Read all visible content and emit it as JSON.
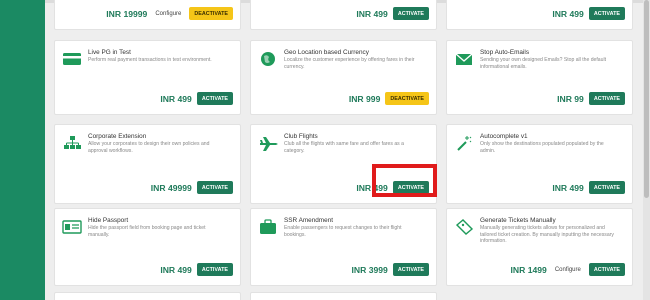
{
  "cards": [
    {
      "price": "INR 19999",
      "configure": "Configure",
      "button": "DEACTIVATE"
    },
    {
      "price": "INR 499",
      "button": "ACTIVATE"
    },
    {
      "price": "INR 499",
      "button": "ACTIVATE"
    },
    {
      "icon": "card-icon",
      "title": "Live PG in Test",
      "desc": "Perform real payment transactions in test environment.",
      "price": "INR 499",
      "button": "ACTIVATE"
    },
    {
      "icon": "globe-icon",
      "title": "Geo Location based Currency",
      "desc": "Localize the customer experience by offering fares in their currency.",
      "price": "INR 999",
      "button": "DEACTIVATE"
    },
    {
      "icon": "envelope-icon",
      "title": "Stop Auto-Emails",
      "desc": "Sending your own designed Emails? Stop all the default informational emails.",
      "price": "INR 99",
      "button": "ACTIVATE"
    },
    {
      "icon": "org-chart-icon",
      "title": "Corporate Extension",
      "desc": "Allow your corporates to design their own policies and approval workflows.",
      "price": "INR 49999",
      "button": "ACTIVATE"
    },
    {
      "icon": "airplane-icon",
      "title": "Club Flights",
      "desc": "Club all the flights with same fare and offer fares as a category.",
      "price": "INR 499",
      "button": "ACTIVATE"
    },
    {
      "icon": "cursor-icon",
      "title": "Autocomplete v1",
      "desc": "Only show the destinations populated populated by the admin.",
      "price": "INR 499",
      "button": "ACTIVATE"
    },
    {
      "icon": "id-card-icon",
      "title": "Hide Passport",
      "desc": "Hide the passport field from booking page and ticket manually.",
      "price": "INR 499",
      "button": "ACTIVATE"
    },
    {
      "icon": "suitcase-icon",
      "title": "SSR Amendment",
      "desc": "Enable passengers to request changes to their flight bookings.",
      "price": "INR 3999",
      "button": "ACTIVATE"
    },
    {
      "icon": "ticket-icon",
      "title": "Generate Tickets Manually",
      "desc": "Manually generating tickets allows for personalized and tailored ticket creation. By manually inputting the necessary information.",
      "price": "INR 1499",
      "configure": "Configure",
      "button": "ACTIVATE"
    }
  ]
}
